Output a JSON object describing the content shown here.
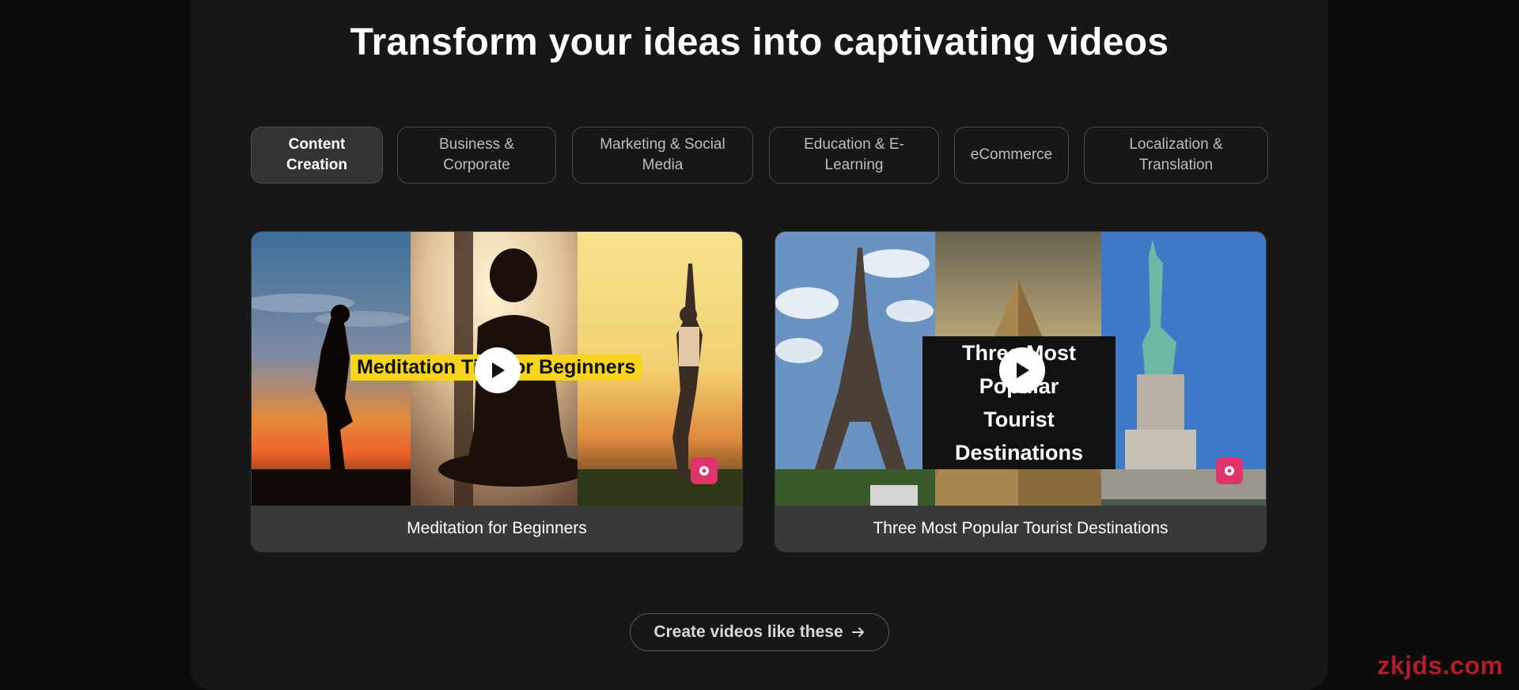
{
  "heading": "Transform your ideas into captivating videos",
  "tabs": [
    {
      "label": "Content\nCreation",
      "active": true
    },
    {
      "label": "Business &\nCorporate",
      "active": false
    },
    {
      "label": "Marketing & Social\nMedia",
      "active": false
    },
    {
      "label": "Education & E-\nLearning",
      "active": false
    },
    {
      "label": "eCommerce",
      "active": false
    },
    {
      "label": "Localization &\nTranslation",
      "active": false
    }
  ],
  "cards": [
    {
      "label": "Meditation for Beginners",
      "overlay_title": "Meditation Tips for Beginners"
    },
    {
      "label": "Three Most Popular Tourist Destinations",
      "overlay_line1": "Three Most Popular",
      "overlay_line2": "Tourist Destinations"
    }
  ],
  "cta": {
    "label": "Create videos like these",
    "icon": "arrow-right-icon"
  },
  "watermark": "zkjds.com",
  "colors": {
    "page_bg": "#0c0c0c",
    "panel_bg": "#171717",
    "tab_active_bg": "#333333",
    "card_footer_bg": "#3a3939",
    "yellow_caption": "#f6d31e",
    "badge_pink": "#e0336a",
    "watermark_red": "#b31d2a"
  }
}
